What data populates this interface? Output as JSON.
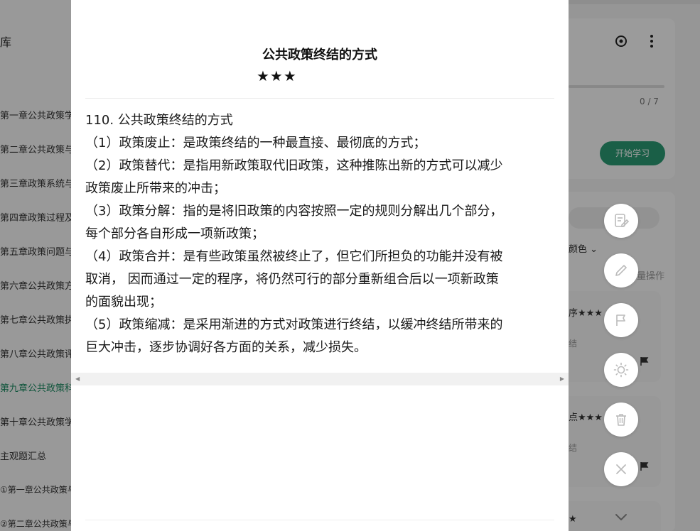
{
  "background": {
    "sidebar": {
      "title": "库",
      "chapters": [
        {
          "label": "第一章公共政策学"
        },
        {
          "label": "第二章公共政策与"
        },
        {
          "label": "第三章政策系统与"
        },
        {
          "label": "第四章政策过程及"
        },
        {
          "label": "第五章政策问题与"
        },
        {
          "label": "第六章公共政策方"
        },
        {
          "label": "第七章公共政策执"
        },
        {
          "label": "第八章公共政策评"
        },
        {
          "label": "第九章公共政策科"
        },
        {
          "label": "第十章公共政策学"
        },
        {
          "label": "主观题汇总"
        },
        {
          "label": "①第一章公共政策与"
        },
        {
          "label": "②第二章公共政策与"
        }
      ]
    },
    "right_panel": {
      "progress_text": "0 / 7",
      "start_button": "开始学习",
      "color_filter": "颜色",
      "batch_op": "量操作",
      "card1_title": "序★★★",
      "card1_sub": "结",
      "card2_title": "点★★★",
      "card2_sub": "结",
      "card3_title": "★"
    }
  },
  "modal": {
    "title": "公共政策终结的方式",
    "stars": "★★★",
    "content_lines": [
      "110. 公共政策终结的方式",
      "（1）政策废止：是政策终结的一种最直接、最彻底的方式；",
      "（2）政策替代：是指用新政策取代旧政策，这种推陈出新的方式可以减少",
      "政策废止所带来的冲击；",
      "（3）政策分解：指的是将旧政策的内容按照一定的规则分解出几个部分，",
      "每个部分各自形成一项新政策；",
      "（4）政策合并：是有些政策虽然被终止了，但它们所担负的功能并没有被",
      "取消， 因而通过一定的程序，将仍然可行的部分重新组合后以一项新政策",
      "的面貌出现；",
      "（5）政策缩减：是采用渐进的方式对政策进行终结，以缓冲终结所带来的",
      "巨大冲击，逐步协调好各方面的关系，减少损失。"
    ]
  },
  "fab_icons": [
    {
      "name": "edit-note-icon"
    },
    {
      "name": "pencil-icon"
    },
    {
      "name": "flag-icon"
    },
    {
      "name": "brightness-icon"
    },
    {
      "name": "trash-icon"
    },
    {
      "name": "close-icon"
    }
  ],
  "colors": {
    "accent": "#2a9a73",
    "active_chapter": "#1a8a62",
    "overlay": "rgba(0,0,0,0.38)"
  }
}
